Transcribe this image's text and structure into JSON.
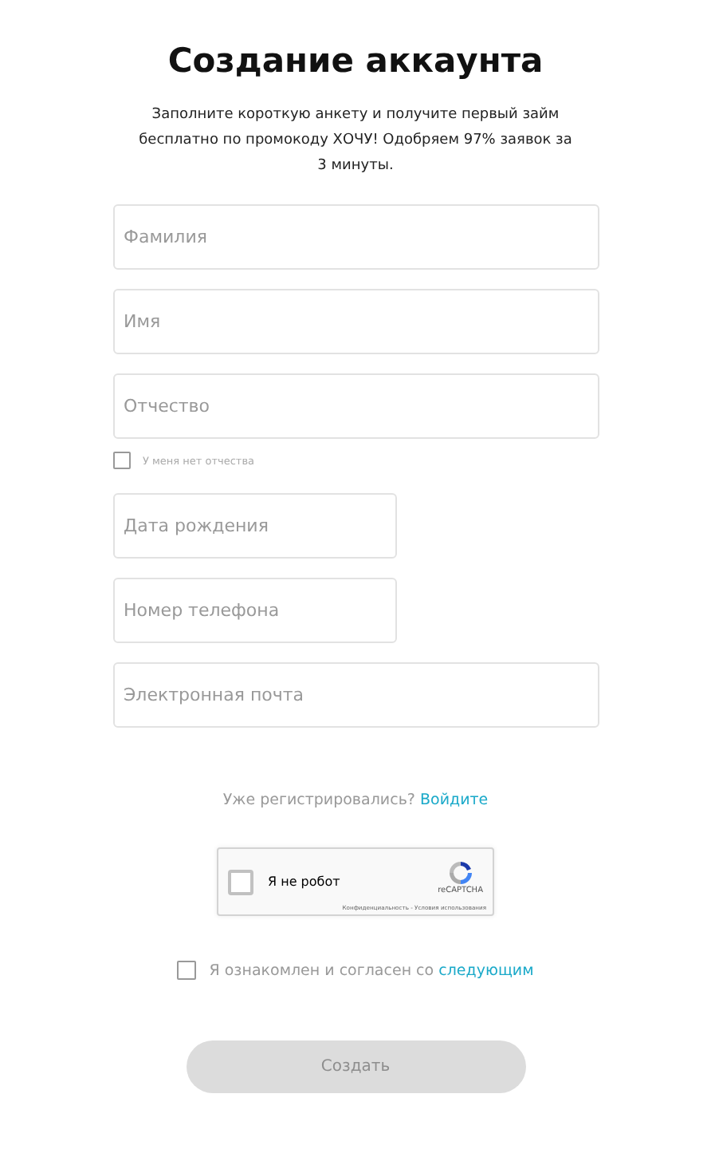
{
  "title": "Создание аккаунта",
  "description": "Заполните короткую анкету и получите первый займ бесплатно по промокоду ХОЧУ! Одобряем 97% заявок за 3 минуты.",
  "fields": [
    {
      "placeholder": "Фамилия",
      "kind": "wide"
    },
    {
      "placeholder": "Имя",
      "kind": "wide"
    },
    {
      "placeholder": "Отчество",
      "kind": "wide"
    },
    {
      "kind": "checkbox",
      "label": "У меня нет отчества",
      "checked": false
    },
    {
      "placeholder": "Дата рождения",
      "kind": "narrow"
    },
    {
      "placeholder": "Номер телефона",
      "kind": "narrow"
    },
    {
      "placeholder": "Электронная почта",
      "kind": "wide"
    }
  ],
  "login_prompt": {
    "text": "Уже регистрировались?",
    "link": "Войдите"
  },
  "captcha": {
    "label": "Я не робот",
    "checked": false,
    "brand": "reCAPTCHA",
    "footer": "Конфиденциальность - Условия использования"
  },
  "agreement": {
    "text": "Я ознакомлен и согласен со",
    "link": "следующим",
    "checked": false
  },
  "submit": {
    "label": "Создать",
    "disabled": true
  }
}
